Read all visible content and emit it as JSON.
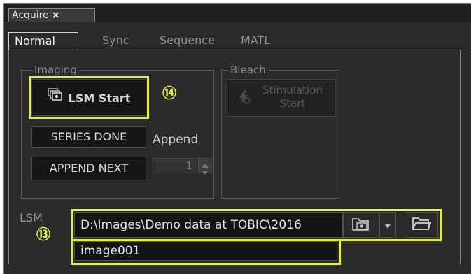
{
  "window": {
    "tab_label": "Acquire",
    "close_glyph": "×"
  },
  "subtabs": [
    "Normal",
    "Sync",
    "Sequence",
    "MATL"
  ],
  "imaging": {
    "legend": "Imaging",
    "lsm_start_label": "LSM Start",
    "series_done_label": "SERIES DONE",
    "append_label": "Append",
    "append_next_label": "APPEND NEXT",
    "append_value": "1"
  },
  "bleach": {
    "legend": "Bleach",
    "stimulation_line1": "Stimulation",
    "stimulation_line2": "Start"
  },
  "lsm": {
    "label": "LSM",
    "path_value": "D:\\Images\\Demo data at TOBIC\\2016",
    "filename_value": "image001"
  },
  "callouts": {
    "c13": "⑬",
    "c14": "⑭"
  },
  "colors": {
    "highlight": "#e2f03c",
    "background": "#2b2b2b"
  },
  "icons": [
    "close-icon",
    "lsm-start-icon",
    "stimulation-icon",
    "image-folder-icon",
    "dropdown-arrow-icon",
    "folder-icon",
    "spin-up-icon",
    "spin-down-icon"
  ]
}
